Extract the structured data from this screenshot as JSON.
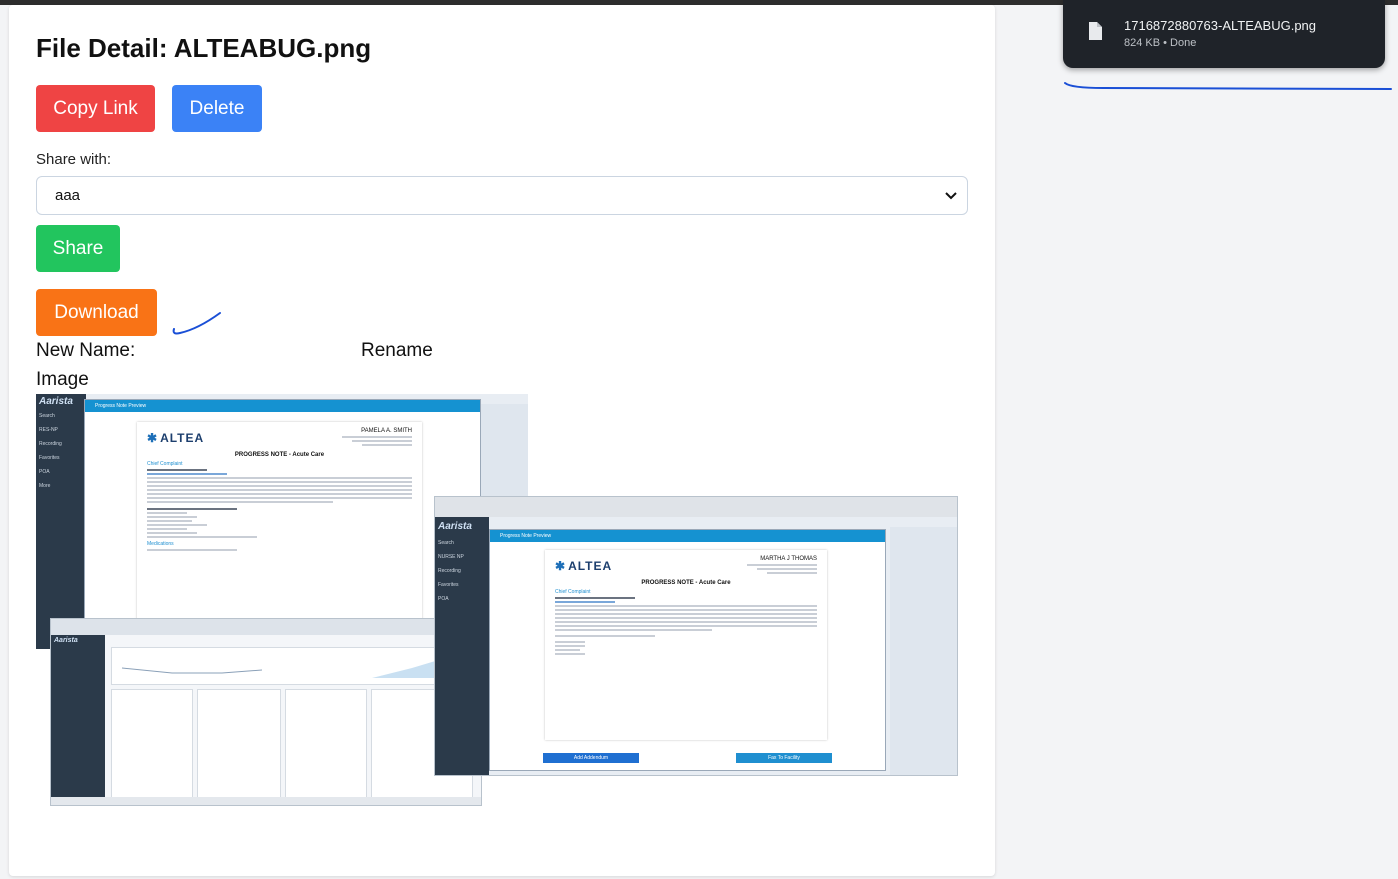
{
  "page": {
    "title": "File Detail: ALTEABUG.png",
    "copy_link_label": "Copy Link",
    "delete_label": "Delete",
    "share_with_label": "Share with:",
    "share_select_value": "aaa",
    "share_label": "Share",
    "download_label": "Download",
    "new_name_label": "New Name:",
    "rename_label": "Rename",
    "image_label": "Image"
  },
  "download_popup": {
    "filename": "1716872880763-ALTEABUG.png",
    "status": "824 KB • Done"
  },
  "preview": {
    "app_name": "Aarista",
    "modal_title": "Progress Note Preview",
    "note1": {
      "brand": "ALTEA",
      "patient": "PAMELA A. SMITH",
      "doc_title": "PROGRESS NOTE - Acute Care",
      "chief_complaint": "Chief Complaint",
      "medications": "Medications"
    },
    "note2": {
      "brand": "ALTEA",
      "patient": "MARTHA J THOMAS",
      "doc_title": "PROGRESS NOTE - Acute Care",
      "chief_complaint": "Chief Complaint",
      "add_addendum": "Add Addendum",
      "fax_to_facility": "Fax To Facility"
    }
  },
  "colors": {
    "copy": "#ef4444",
    "delete": "#3b82f6",
    "share": "#22c55e",
    "download": "#f97316",
    "popup_bg": "#1f2329",
    "annotation": "#1a4fd6"
  }
}
